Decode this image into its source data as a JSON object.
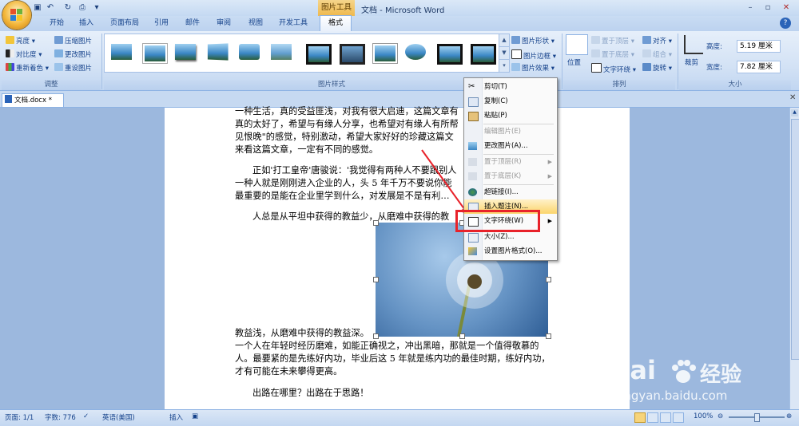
{
  "title_bar": {
    "contextual_tab_group": "图片工具",
    "title": "文档 - Microsoft Word"
  },
  "tabs": [
    "开始",
    "插入",
    "页面布局",
    "引用",
    "邮件",
    "审阅",
    "视图",
    "开发工具",
    "格式"
  ],
  "ribbon": {
    "adjust": {
      "brightness": "亮度",
      "contrast": "对比度",
      "recolor": "重新着色",
      "compress": "压缩图片",
      "change_picture": "更改图片",
      "reset_picture": "重设图片",
      "label": "调整"
    },
    "picture_styles": {
      "label": "图片样式",
      "shape": "图片形状",
      "border": "图片边框",
      "effects": "图片效果"
    },
    "arrange": {
      "label": "排列",
      "position": "位置",
      "bring_to_front": "置于顶层",
      "send_to_back": "置于底层",
      "text_wrap": "文字环绕",
      "align": "对齐",
      "group": "组合",
      "rotate": "旋转"
    },
    "size": {
      "label": "大小",
      "crop": "裁剪",
      "height_label": "高度:",
      "height_value": "5.19 厘米",
      "width_label": "宽度:",
      "width_value": "7.82 厘米"
    }
  },
  "doc_tab": "文档.docx *",
  "document": {
    "lines": [
      "一种生活，真的受益匪浅，对我有很大启迪，这篇文章有",
      "真的太好了，希望与有缘人分享，也希望对有缘人有所帮",
      "见恨晚\"的感觉，特别激动，希望大家好好的珍藏这篇文",
      "来看这篇文章，一定有不同的感觉。",
      "正如'打工皇帝'唐骏说：'我觉得有两种人不要跟别人",
      "一种人就是刚刚进入企业的人，头 5 年千万不要说你能",
      "最重要的是能在企业里学到什么，对发展是不是有利…",
      "人总是从平坦中获得的教益少，从磨难中获得的教",
      "教益浅，从磨难中获得的教益深。",
      "一个人在年轻时经历磨难，如能正确视之，冲出黑暗，那就是一个值得敬慕的",
      "人。最要紧的是先练好内功，毕业后这 5 年就是练内功的最佳时期，练好内功，",
      "才有可能在未来攀得更高。",
      "出路在哪里？出路在于思路！"
    ]
  },
  "context_menu": {
    "items": [
      {
        "label": "剪切(T)",
        "enabled": true,
        "icon": "scissors-icon"
      },
      {
        "label": "复制(C)",
        "enabled": true,
        "icon": "copy-icon"
      },
      {
        "label": "粘贴(P)",
        "enabled": true,
        "icon": "paste-icon"
      },
      {
        "label": "编辑图片(E)",
        "enabled": false,
        "icon": ""
      },
      {
        "label": "更改图片(A)...",
        "enabled": true,
        "icon": "picture-icon"
      },
      {
        "label": "置于顶层(R)",
        "enabled": false,
        "icon": "bring-front-icon",
        "submenu": true
      },
      {
        "label": "置于底层(K)",
        "enabled": false,
        "icon": "send-back-icon",
        "submenu": true
      },
      {
        "label": "超链接(I)...",
        "enabled": true,
        "icon": "hyperlink-icon"
      },
      {
        "label": "插入题注(N)...",
        "enabled": true,
        "icon": "caption-icon"
      },
      {
        "label": "文字环绕(W)",
        "enabled": true,
        "icon": "text-wrap-icon",
        "submenu": true,
        "highlighted": true
      },
      {
        "label": "大小(Z)...",
        "enabled": true,
        "icon": "size-icon"
      },
      {
        "label": "设置图片格式(O)...",
        "enabled": true,
        "icon": "format-picture-icon"
      }
    ]
  },
  "status_bar": {
    "page": "页面: 1/1",
    "words": "字数: 776",
    "language": "英语(美国)",
    "mode": "插入",
    "zoom": "100%"
  },
  "watermark": {
    "brand": "Bai",
    "brand2": "经验",
    "url": "jingyan.baidu.com"
  },
  "colors": {
    "highlight_box": "#e8222a",
    "arrow": "#e8222a",
    "menu_hover": "#fbd56c"
  }
}
